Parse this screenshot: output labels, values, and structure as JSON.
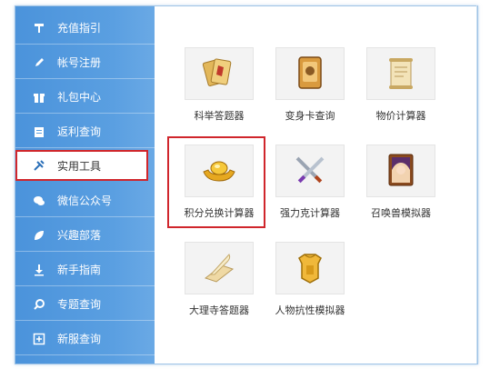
{
  "sidebar": {
    "items": [
      {
        "label": "充值指引",
        "icon": "thumbtack-icon"
      },
      {
        "label": "帐号注册",
        "icon": "pencil-icon"
      },
      {
        "label": "礼包中心",
        "icon": "gift-icon"
      },
      {
        "label": "返利查询",
        "icon": "clipboard-icon"
      },
      {
        "label": "实用工具",
        "icon": "tools-icon",
        "active": true
      },
      {
        "label": "微信公众号",
        "icon": "wechat-icon"
      },
      {
        "label": "兴趣部落",
        "icon": "leaf-icon"
      },
      {
        "label": "新手指南",
        "icon": "download-icon"
      },
      {
        "label": "专题查询",
        "icon": "magnifier-icon"
      },
      {
        "label": "新服查询",
        "icon": "plus-square-icon"
      }
    ]
  },
  "tools": [
    {
      "label": "科举答题器",
      "icon": "exam-cards-icon"
    },
    {
      "label": "变身卡查询",
      "icon": "transform-card-icon"
    },
    {
      "label": "物价计算器",
      "icon": "scroll-icon"
    },
    {
      "label": "积分兑换计算器",
      "icon": "gold-ingot-icon",
      "highlighted": true
    },
    {
      "label": "强力克计算器",
      "icon": "crossed-swords-icon"
    },
    {
      "label": "召唤兽模拟器",
      "icon": "summon-portrait-icon"
    },
    {
      "label": "大理寺答题器",
      "icon": "quill-paper-icon"
    },
    {
      "label": "人物抗性模拟器",
      "icon": "armor-icon"
    }
  ],
  "colors": {
    "sidebar_blue": "#4b93db",
    "highlight_red": "#d0262c"
  }
}
